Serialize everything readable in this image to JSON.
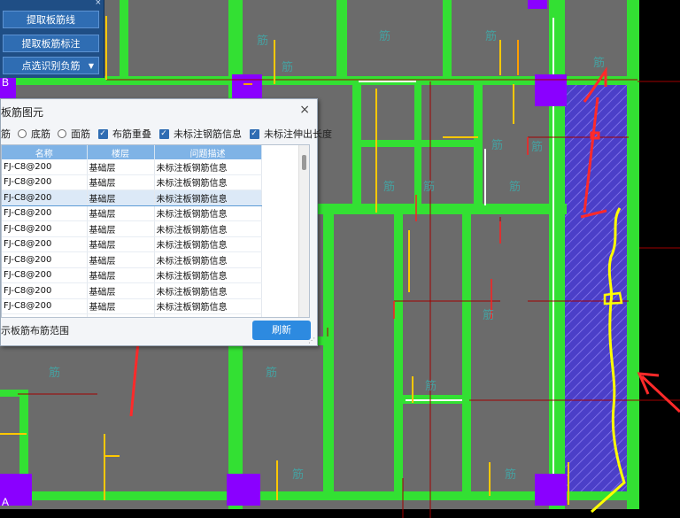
{
  "toolbar": {
    "close": "×",
    "buttons": [
      "提取板筋线",
      "提取板筋标注",
      "点选识别负筋"
    ],
    "dropdown_arrow": "▼"
  },
  "dialog": {
    "title": "板筋图元",
    "close": "×",
    "filters": {
      "radio1": "筋",
      "radio2": "底筋",
      "radio3": "面筋",
      "check1": "布筋重叠",
      "check2": "未标注钢筋信息",
      "check3": "未标注伸出长度"
    },
    "columns": [
      "名称",
      "楼层",
      "问题描述"
    ],
    "rows": [
      [
        "FJ-C8@200",
        "基础层",
        "未标注板钢筋信息"
      ],
      [
        "FJ-C8@200",
        "基础层",
        "未标注板钢筋信息"
      ],
      [
        "FJ-C8@200",
        "基础层",
        "未标注板钢筋信息"
      ],
      [
        "FJ-C8@200",
        "基础层",
        "未标注板钢筋信息"
      ],
      [
        "FJ-C8@200",
        "基础层",
        "未标注板钢筋信息"
      ],
      [
        "FJ-C8@200",
        "基础层",
        "未标注板钢筋信息"
      ],
      [
        "FJ-C8@200",
        "基础层",
        "未标注板钢筋信息"
      ],
      [
        "FJ-C8@200",
        "基础层",
        "未标注板钢筋信息"
      ],
      [
        "FJ-C8@200",
        "基础层",
        "未标注板钢筋信息"
      ],
      [
        "FJ-C8@200",
        "基础层",
        "未标注板钢筋信息"
      ],
      [
        "FJ-C8@200",
        "基础层",
        "未标注板钢筋信息"
      ]
    ],
    "selected_row": 2,
    "bottom_label": "示板筋布筋范围",
    "refresh": "刷新"
  },
  "canvas": {
    "axis_b": "B",
    "axis_a": "A"
  },
  "colors": {
    "beam": "#3fe03f",
    "slab": "#666666",
    "column": "#8a2be2",
    "rebar": "#ffff00",
    "annotation": "#ff3030",
    "hatch": "#5a4fd6"
  }
}
